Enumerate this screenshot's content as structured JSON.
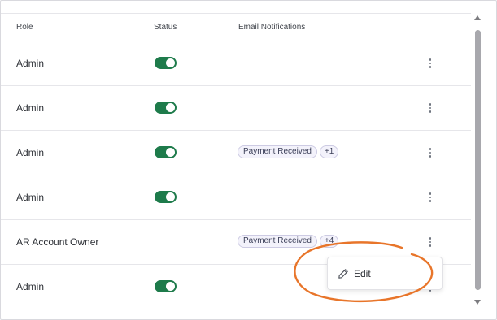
{
  "table": {
    "columns": {
      "role": "Role",
      "status": "Status",
      "email": "Email Notifications"
    },
    "rows": [
      {
        "role": "Admin",
        "status_on": true,
        "chips": []
      },
      {
        "role": "Admin",
        "status_on": true,
        "chips": []
      },
      {
        "role": "Admin",
        "status_on": true,
        "chips": [
          "Payment Received",
          "+1"
        ]
      },
      {
        "role": "Admin",
        "status_on": true,
        "chips": []
      },
      {
        "role": "AR Account Owner",
        "status_on": false,
        "chips": [
          "Payment Received",
          "+4"
        ]
      },
      {
        "role": "Admin",
        "status_on": true,
        "chips": []
      }
    ]
  },
  "menu": {
    "edit_label": "Edit"
  },
  "colors": {
    "toggle_on": "#1e7b4b",
    "highlight": "#e8752a"
  },
  "icons": {
    "row_actions": "kebab-menu-icon",
    "edit": "pencil-icon"
  }
}
